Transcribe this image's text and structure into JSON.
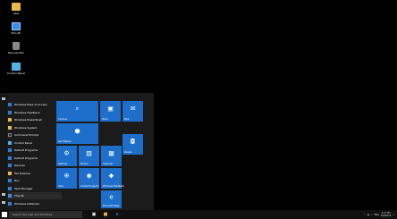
{
  "desktop": {
    "icons": [
      {
        "label": "User",
        "icon": "user-folder-icon"
      },
      {
        "label": "This PC",
        "icon": "computer-icon"
      },
      {
        "label": "Recycle Bin",
        "icon": "recycle-bin-icon"
      },
      {
        "label": "Control Panel",
        "icon": "control-panel-icon"
      }
    ]
  },
  "start_menu": {
    "apps": [
      {
        "label": "Windows Ease of Access",
        "arrow": ""
      },
      {
        "label": "Windows Feedback",
        "arrow": ""
      },
      {
        "label": "Windows PowerShell",
        "arrow": "˅"
      },
      {
        "label": "Windows System",
        "arrow": "˄"
      },
      {
        "label": "Command Prompt",
        "arrow": ""
      },
      {
        "label": "Control Panel",
        "arrow": ""
      },
      {
        "label": "Default Programs",
        "arrow": ""
      },
      {
        "label": "Default Programs",
        "arrow": ""
      },
      {
        "label": "Devices",
        "arrow": ""
      },
      {
        "label": "File Explorer",
        "arrow": ""
      },
      {
        "label": "Run",
        "arrow": ""
      },
      {
        "label": "Task Manager",
        "arrow": ""
      },
      {
        "label": "This PC",
        "arrow": ""
      },
      {
        "label": "Windows Defender",
        "arrow": ""
      }
    ],
    "back_label": "Back",
    "tiles": [
      {
        "label": "Cortana",
        "icon": "⌕"
      },
      {
        "label": "Store",
        "icon": "▣"
      },
      {
        "label": "Mail",
        "icon": "✉"
      },
      {
        "label": "Get Started",
        "icon": "●"
      },
      {
        "label": "People",
        "icon": "◘"
      },
      {
        "label": "Settings",
        "icon": "⚙"
      },
      {
        "label": "Photos",
        "icon": "▧"
      },
      {
        "label": "Calendar",
        "icon": "▦"
      },
      {
        "label": "Xbox",
        "icon": "⊕"
      },
      {
        "label": "Contact Support",
        "icon": "◉"
      },
      {
        "label": "Windows Feedback",
        "icon": "◆"
      },
      {
        "label": "Microsoft Edge",
        "icon": "e"
      }
    ]
  },
  "taskbar": {
    "search_placeholder": "Search the web and Windows",
    "icons": [
      "task-view-icon",
      "file-explorer-icon",
      "edge-icon"
    ],
    "tray": {
      "lang": "ENG",
      "time": "4:27 PM",
      "date": "6/4/2016"
    }
  },
  "colors": {
    "tile_blue": "#1e6fcb",
    "start_bg": "#1b1b1b",
    "taskbar_bg": "#101010"
  }
}
